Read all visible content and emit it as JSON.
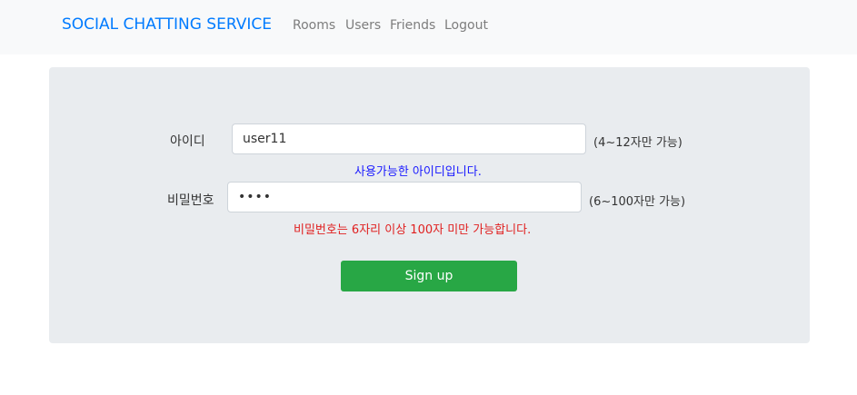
{
  "navbar": {
    "brand": "SOCIAL CHATTING SERVICE",
    "links": [
      "Rooms",
      "Users",
      "Friends",
      "Logout"
    ]
  },
  "form": {
    "id_label": "아이디",
    "id_value": "user11",
    "id_hint": "(4~12자만 가능)",
    "id_message": "사용가능한 아이디입니다.",
    "pw_label": "비밀번호",
    "pw_value": "••••",
    "pw_hint": "(6~100자만 가능)",
    "pw_message": "비밀번호는 6자리 이상 100자 미만 가능합니다.",
    "submit_label": "Sign up"
  },
  "colors": {
    "brand": "#007bff",
    "success_message": "#1a1aff",
    "error_message": "#e02020",
    "submit_button": "#28a745"
  }
}
